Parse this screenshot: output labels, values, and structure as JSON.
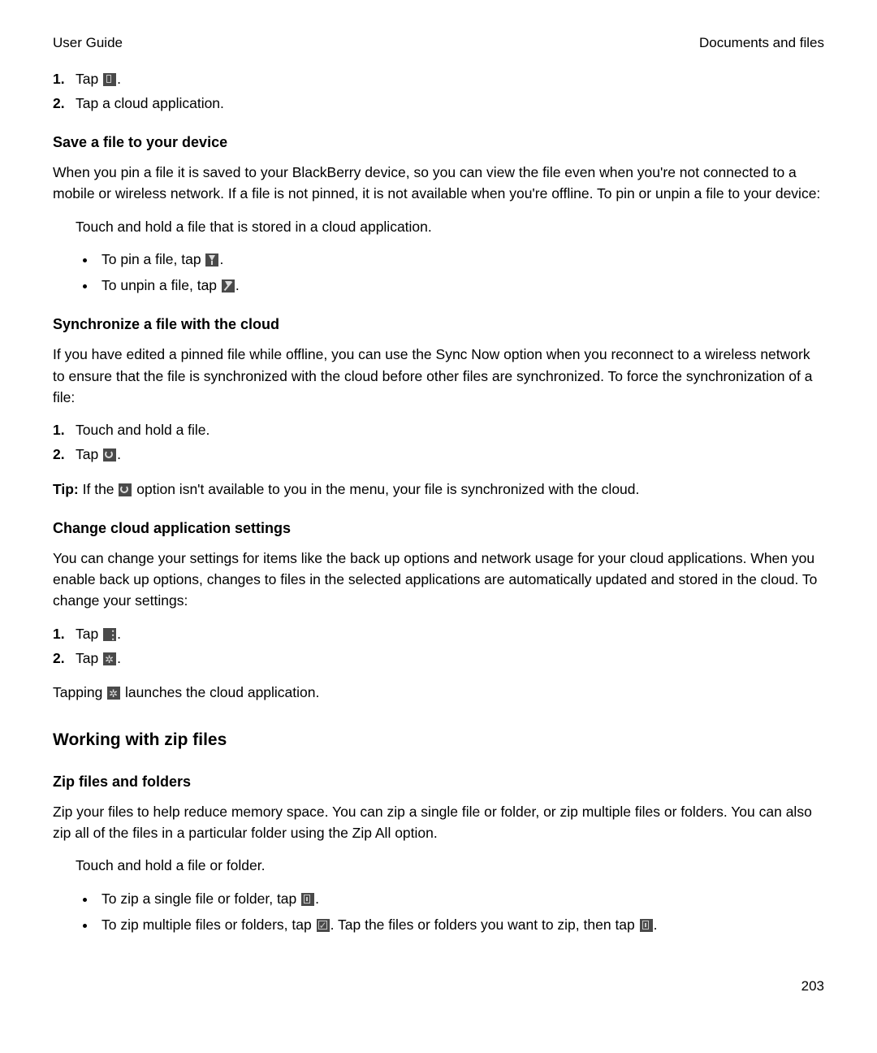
{
  "header": {
    "left": "User Guide",
    "right": "Documents and files"
  },
  "topList": {
    "item1_pre": "Tap ",
    "item1_post": ".",
    "item2": "Tap a cloud application."
  },
  "saveFile": {
    "heading": "Save a file to your device",
    "para": "When you pin a file it is saved to your BlackBerry device, so you can view the file even when you're not connected to a mobile or wireless network. If a file is not pinned, it is not available when you're offline. To pin or unpin a file to your device:",
    "step": "Touch and hold a file that is stored in a cloud application.",
    "bullet1_pre": "To pin a file, tap ",
    "bullet1_post": ".",
    "bullet2_pre": "To unpin a file, tap ",
    "bullet2_post": "."
  },
  "sync": {
    "heading": "Synchronize a file with the cloud",
    "para": "If you have edited a pinned file while offline, you can use the Sync Now option when you reconnect to a wireless network to ensure that the file is synchronized with the cloud before other files are synchronized. To force the synchronization of a file:",
    "step1": "Touch and hold a file.",
    "step2_pre": "Tap ",
    "step2_post": ".",
    "tip_label": "Tip: ",
    "tip_pre": "If the ",
    "tip_post": " option isn't available to you in the menu, your file is synchronized with the cloud."
  },
  "settings": {
    "heading": "Change cloud application settings",
    "para": "You can change your settings for items like the back up options and network usage for your cloud applications. When you enable back up options, changes to files in the selected applications are automatically updated and stored in the cloud. To change your settings:",
    "step1_pre": "Tap ",
    "step1_post": ".",
    "step2_pre": "Tap ",
    "step2_post": ".",
    "note_pre": "Tapping ",
    "note_post": " launches the cloud application."
  },
  "zipSection": {
    "heading": "Working with zip files",
    "sub": "Zip files and folders",
    "para": "Zip your files to help reduce memory space. You can zip a single file or folder, or zip multiple files or folders. You can also zip all of the files in a particular folder using the Zip All option.",
    "step": "Touch and hold a file or folder.",
    "bullet1_pre": "To zip a single file or folder, tap ",
    "bullet1_post": ".",
    "bullet2_pre": "To zip multiple files or folders, tap ",
    "bullet2_mid": ". Tap the files or folders you want to zip, then tap ",
    "bullet2_post": "."
  },
  "pageNumber": "203"
}
